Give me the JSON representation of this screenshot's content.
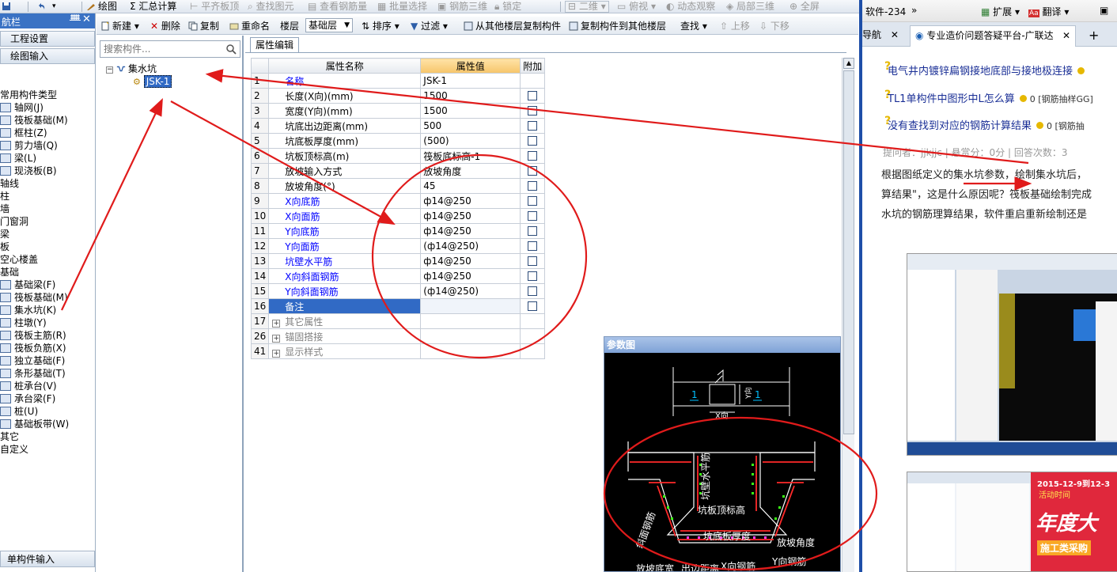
{
  "toolbar": {
    "draw": "绘图",
    "summary": "汇总计算",
    "flush_slab": "平齐板顶",
    "find_element": "查找图元",
    "view_rebar": "查看钢筋量",
    "batch_select": "批量选择",
    "rebar_3d": "钢筋三维",
    "lock": "锁定",
    "view_2d": "二维",
    "top_view": "俯视",
    "dynamic_observe": "动态观察",
    "local_3d": "局部三维",
    "fullscreen": "全屏"
  },
  "left_panel": {
    "title": "航栏",
    "buttons": [
      "工程设置",
      "绘图输入"
    ],
    "nav_items": [
      {
        "label": "常用构件类型",
        "icon": false
      },
      {
        "label": "轴网(J)",
        "icon": true
      },
      {
        "label": "筏板基础(M)",
        "icon": true
      },
      {
        "label": "框柱(Z)",
        "icon": true
      },
      {
        "label": "剪力墙(Q)",
        "icon": true
      },
      {
        "label": "梁(L)",
        "icon": true
      },
      {
        "label": "现浇板(B)",
        "icon": true
      },
      {
        "label": "轴线",
        "icon": false
      },
      {
        "label": "柱",
        "icon": false
      },
      {
        "label": "墙",
        "icon": false
      },
      {
        "label": "门窗洞",
        "icon": false
      },
      {
        "label": "梁",
        "icon": false
      },
      {
        "label": "板",
        "icon": false
      },
      {
        "label": "空心楼盖",
        "icon": false
      },
      {
        "label": "基础",
        "icon": false
      },
      {
        "label": "基础梁(F)",
        "icon": true
      },
      {
        "label": "筏板基础(M)",
        "icon": true
      },
      {
        "label": "集水坑(K)",
        "icon": true
      },
      {
        "label": "柱墩(Y)",
        "icon": true
      },
      {
        "label": "筏板主筋(R)",
        "icon": true
      },
      {
        "label": "筏板负筋(X)",
        "icon": true
      },
      {
        "label": "独立基础(F)",
        "icon": true
      },
      {
        "label": "条形基础(T)",
        "icon": true
      },
      {
        "label": "桩承台(V)",
        "icon": true
      },
      {
        "label": "承台梁(F)",
        "icon": true
      },
      {
        "label": "桩(U)",
        "icon": true
      },
      {
        "label": "基础板带(W)",
        "icon": true
      },
      {
        "label": "其它",
        "icon": false
      },
      {
        "label": "自定义",
        "icon": false
      }
    ],
    "bottom_button": "单构件输入"
  },
  "component_toolbar": {
    "new": "新建",
    "delete": "删除",
    "copy": "复制",
    "rename": "重命名",
    "floor_label": "楼层",
    "floor_value": "基础层",
    "sort": "排序",
    "filter": "过滤",
    "copy_from_other": "从其他楼层复制构件",
    "copy_to_other": "复制构件到其他楼层",
    "find": "查找",
    "move_up": "上移",
    "move_down": "下移"
  },
  "tree": {
    "search_placeholder": "搜索构件...",
    "root": "集水坑",
    "child": "JSK-1"
  },
  "property_editor": {
    "tab": "属性编辑",
    "headers": {
      "name": "属性名称",
      "value": "属性值",
      "extra": "附加"
    },
    "rows": [
      {
        "idx": "1",
        "name": "名称",
        "value": "JSK-1",
        "color": "blue",
        "chk": false,
        "expand": false
      },
      {
        "idx": "2",
        "name": "长度(X向)(mm)",
        "value": "1500",
        "color": "black",
        "chk": true,
        "expand": false
      },
      {
        "idx": "3",
        "name": "宽度(Y向)(mm)",
        "value": "1500",
        "color": "black",
        "chk": true,
        "expand": false
      },
      {
        "idx": "4",
        "name": "坑底出边距离(mm)",
        "value": "500",
        "color": "black",
        "chk": true,
        "expand": false
      },
      {
        "idx": "5",
        "name": "坑底板厚度(mm)",
        "value": "(500)",
        "color": "black",
        "chk": true,
        "expand": false
      },
      {
        "idx": "6",
        "name": "坑板顶标高(m)",
        "value": "筏板底标高-1",
        "color": "black",
        "chk": true,
        "expand": false
      },
      {
        "idx": "7",
        "name": "放坡输入方式",
        "value": "放坡角度",
        "color": "black",
        "chk": true,
        "expand": false
      },
      {
        "idx": "8",
        "name": "放坡角度(°)",
        "value": "45",
        "color": "black",
        "chk": true,
        "expand": false
      },
      {
        "idx": "9",
        "name": "X向底筋",
        "value": "ф14@250",
        "color": "blue",
        "chk": true,
        "expand": false
      },
      {
        "idx": "10",
        "name": "X向面筋",
        "value": "ф14@250",
        "color": "blue",
        "chk": true,
        "expand": false
      },
      {
        "idx": "11",
        "name": "Y向底筋",
        "value": "ф14@250",
        "color": "blue",
        "chk": true,
        "expand": false
      },
      {
        "idx": "12",
        "name": "Y向面筋",
        "value": "(ф14@250)",
        "color": "blue",
        "chk": true,
        "expand": false
      },
      {
        "idx": "13",
        "name": "坑壁水平筋",
        "value": "ф14@250",
        "color": "blue",
        "chk": true,
        "expand": false
      },
      {
        "idx": "14",
        "name": "X向斜面钢筋",
        "value": "ф14@250",
        "color": "blue",
        "chk": true,
        "expand": false
      },
      {
        "idx": "15",
        "name": "Y向斜面钢筋",
        "value": "(ф14@250)",
        "color": "blue",
        "chk": true,
        "expand": false
      },
      {
        "idx": "16",
        "name": "备注",
        "value": "",
        "color": "black",
        "chk": true,
        "expand": false,
        "selected": true
      },
      {
        "idx": "17",
        "name": "其它属性",
        "value": "",
        "color": "gray",
        "chk": false,
        "expand": true
      },
      {
        "idx": "26",
        "name": "锚固搭接",
        "value": "",
        "color": "gray",
        "chk": false,
        "expand": true
      },
      {
        "idx": "41",
        "name": "显示样式",
        "value": "",
        "color": "gray",
        "chk": false,
        "expand": true
      }
    ]
  },
  "param_diagram": {
    "title": "参数图",
    "labels": {
      "x_dir": "X向",
      "y_dir": "Y向",
      "mark": "1",
      "wall_bar": "坑壁水平筋",
      "top_elev": "坑板顶标高",
      "bottom_thick": "坑底板厚度",
      "slope_angle": "放坡角度",
      "slope_bar": "斜面钢筋",
      "slope_width": "放坡底宽",
      "edge_dist": "出边距离",
      "x_bar": "X向钢筋",
      "y_bar": "Y向钢筋",
      "section": "1-1"
    }
  },
  "browser": {
    "app_label": "软件-234",
    "more": "»",
    "ext": "扩展",
    "translate": "翻译",
    "tabs": [
      {
        "label": "导航",
        "active": false
      },
      {
        "label": "专业造价问题答疑平台-广联达",
        "active": true
      }
    ],
    "new_tab": "+",
    "questions": [
      {
        "text": "电气井内镀锌扁钢接地底部与接地极连接",
        "tail": ""
      },
      {
        "text": "TL1单构件中图形中L怎么算",
        "tail": "0  [钢筋抽样GG]"
      },
      {
        "text": "没有查找到对应的钢筋计算结果",
        "tail": "0  [钢筋抽"
      }
    ],
    "meta": "提问者：jjkjjc  |  悬赏分：0分  |  回答次数：3",
    "body_lines": [
      "根据图纸定义的集水坑参数，绘制集水坑后，",
      "算结果\"，这是什么原因呢？筏板基础绘制完成",
      "水坑的钢筋理算结果，软件重启重新绘制还是"
    ],
    "promo": {
      "date": "2015-12-9到12-3",
      "event": "活动时间",
      "big": "年度大",
      "sub": "施工类采购"
    }
  },
  "colors": {
    "annotation": "#e01b1b",
    "selection": "#316ac5",
    "value_header": "#f6c56a",
    "browser_border": "#1e4fa8"
  }
}
